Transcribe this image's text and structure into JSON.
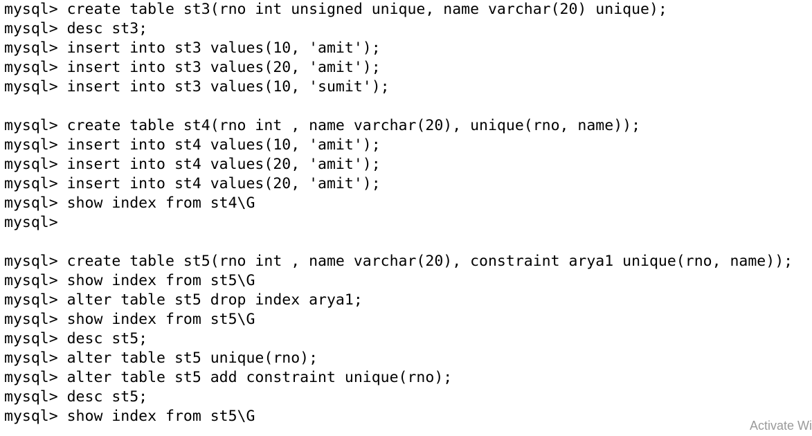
{
  "terminal": {
    "prompt": "mysql> ",
    "lines": [
      {
        "cmd": "create table st3(rno int unsigned unique, name varchar(20) unique);"
      },
      {
        "cmd": "desc st3;"
      },
      {
        "cmd": "insert into st3 values(10, 'amit');"
      },
      {
        "cmd": "insert into st3 values(20, 'amit');"
      },
      {
        "cmd": "insert into st3 values(10, 'sumit');"
      },
      {
        "blank": true
      },
      {
        "cmd": "create table st4(rno int , name varchar(20), unique(rno, name));"
      },
      {
        "cmd": "insert into st4 values(10, 'amit');"
      },
      {
        "cmd": "insert into st4 values(20, 'amit');"
      },
      {
        "cmd": "insert into st4 values(20, 'amit');"
      },
      {
        "cmd": "show index from st4\\G"
      },
      {
        "cmd": ""
      },
      {
        "blank": true
      },
      {
        "cmd": "create table st5(rno int , name varchar(20), constraint arya1 unique(rno, name));"
      },
      {
        "cmd": "show index from st5\\G"
      },
      {
        "cmd": "alter table st5 drop index arya1;"
      },
      {
        "cmd": "show index from st5\\G"
      },
      {
        "cmd": "desc st5;"
      },
      {
        "cmd": "alter table st5 unique(rno);"
      },
      {
        "cmd": "alter table st5 add constraint unique(rno);"
      },
      {
        "cmd": "desc st5;"
      },
      {
        "cmd": "show index from st5\\G"
      }
    ]
  },
  "watermark": "Activate Wi"
}
